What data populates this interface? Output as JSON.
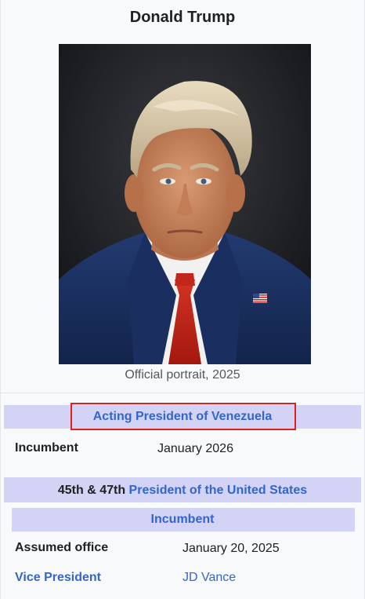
{
  "infobox": {
    "name": "Donald Trump",
    "caption": "Official portrait, 2025"
  },
  "venezuela": {
    "office": "Acting President of Venezuela",
    "status_label": "Incumbent",
    "status_value": "January 2026"
  },
  "us_presidency": {
    "order": "45th & 47th ",
    "office": "President of the United States",
    "status": "Incumbent",
    "assumed_label": "Assumed office",
    "assumed_value": "January 20, 2025",
    "vp_label": "Vice President",
    "vp_value": "JD Vance"
  },
  "colors": {
    "link": "#3366cc",
    "band": "#d3d4f5",
    "highlight": "#e0201b"
  }
}
